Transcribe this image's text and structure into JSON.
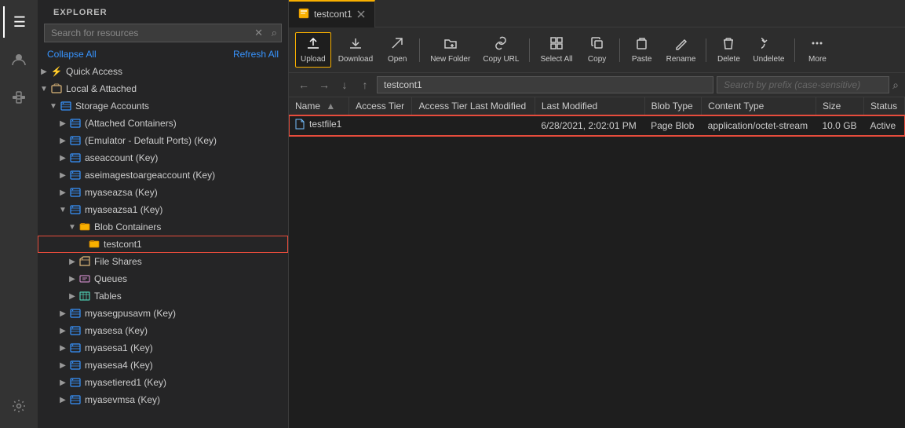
{
  "activityBar": {
    "icons": [
      {
        "name": "menu-icon",
        "glyph": "☰"
      },
      {
        "name": "account-icon",
        "glyph": "👤"
      },
      {
        "name": "plugin-icon",
        "glyph": "🔌"
      },
      {
        "name": "settings-icon",
        "glyph": "⚙"
      }
    ]
  },
  "sidebar": {
    "title": "EXPLORER",
    "search": {
      "placeholder": "Search for resources",
      "value": ""
    },
    "collapseAll": "Collapse All",
    "refreshAll": "Refresh All",
    "quickAccess": "Quick Access",
    "localAttached": "Local & Attached",
    "storageAccounts": "Storage Accounts",
    "tree": [
      {
        "id": "quick-access",
        "label": "Quick Access",
        "indent": 0,
        "chevron": "▶",
        "icon": "⚡"
      },
      {
        "id": "local-attached",
        "label": "Local & Attached",
        "indent": 0,
        "chevron": "▼",
        "icon": "📁",
        "expanded": true
      },
      {
        "id": "storage-accounts",
        "label": "Storage Accounts",
        "indent": 1,
        "chevron": "▼",
        "icon": "🗄",
        "expanded": true
      },
      {
        "id": "attached-containers",
        "label": "(Attached Containers)",
        "indent": 2,
        "chevron": "▶",
        "icon": "🗄"
      },
      {
        "id": "emulator",
        "label": "(Emulator - Default Ports) (Key)",
        "indent": 2,
        "chevron": "▶",
        "icon": "🗄"
      },
      {
        "id": "aseaccount",
        "label": "aseaccount (Key)",
        "indent": 2,
        "chevron": "▶",
        "icon": "🗄"
      },
      {
        "id": "aseimagestorage",
        "label": "aseimagestoargeaccount (Key)",
        "indent": 2,
        "chevron": "▶",
        "icon": "🗄"
      },
      {
        "id": "myaseazsa",
        "label": "myaseazsa (Key)",
        "indent": 2,
        "chevron": "▶",
        "icon": "🗄"
      },
      {
        "id": "myaseazsa1",
        "label": "myaseazsa1 (Key)",
        "indent": 2,
        "chevron": "▼",
        "icon": "🗄",
        "expanded": true
      },
      {
        "id": "blob-containers",
        "label": "Blob Containers",
        "indent": 3,
        "chevron": "▼",
        "icon": "📦",
        "expanded": true
      },
      {
        "id": "testcont1",
        "label": "testcont1",
        "indent": 4,
        "chevron": "",
        "icon": "📦",
        "selected": true,
        "highlighted": true
      },
      {
        "id": "file-shares",
        "label": "File Shares",
        "indent": 3,
        "chevron": "▶",
        "icon": "📁"
      },
      {
        "id": "queues",
        "label": "Queues",
        "indent": 3,
        "chevron": "▶",
        "icon": "📋"
      },
      {
        "id": "tables",
        "label": "Tables",
        "indent": 3,
        "chevron": "▶",
        "icon": "📊"
      },
      {
        "id": "myasegpusavm",
        "label": "myasegpusavm (Key)",
        "indent": 2,
        "chevron": "▶",
        "icon": "🗄"
      },
      {
        "id": "myasesa",
        "label": "myasesa (Key)",
        "indent": 2,
        "chevron": "▶",
        "icon": "🗄"
      },
      {
        "id": "myasesa1",
        "label": "myasesa1 (Key)",
        "indent": 2,
        "chevron": "▶",
        "icon": "🗄"
      },
      {
        "id": "myasesa4",
        "label": "myasesa4 (Key)",
        "indent": 2,
        "chevron": "▶",
        "icon": "🗄"
      },
      {
        "id": "myasetiered1",
        "label": "myasetiered1 (Key)",
        "indent": 2,
        "chevron": "▶",
        "icon": "🗄"
      },
      {
        "id": "myasevmsa",
        "label": "myasevmsa (Key)",
        "indent": 2,
        "chevron": "▶",
        "icon": "🗄"
      }
    ]
  },
  "tab": {
    "label": "testcont1",
    "icon": "📦",
    "modified": false,
    "closable": true
  },
  "toolbar": {
    "buttons": [
      {
        "id": "upload",
        "label": "Upload",
        "icon": "↑",
        "active": true
      },
      {
        "id": "download",
        "label": "Download",
        "icon": "↓",
        "active": false
      },
      {
        "id": "open",
        "label": "Open",
        "icon": "↗",
        "active": false
      },
      {
        "id": "new-folder",
        "label": "New Folder",
        "icon": "+",
        "active": false
      },
      {
        "id": "copy-url",
        "label": "Copy URL",
        "icon": "🔗",
        "active": false
      },
      {
        "id": "select-all",
        "label": "Select All",
        "icon": "⬚",
        "active": false
      },
      {
        "id": "copy",
        "label": "Copy",
        "icon": "⧉",
        "active": false
      },
      {
        "id": "paste",
        "label": "Paste",
        "icon": "📋",
        "active": false
      },
      {
        "id": "rename",
        "label": "Rename",
        "icon": "✏",
        "active": false
      },
      {
        "id": "delete",
        "label": "Delete",
        "icon": "🗑",
        "active": false
      },
      {
        "id": "undelete",
        "label": "Undelete",
        "icon": "↩",
        "active": false
      },
      {
        "id": "more",
        "label": "More",
        "icon": "•••",
        "active": false
      }
    ]
  },
  "addressBar": {
    "navBack": "←",
    "navForward": "→",
    "navDown": "↓",
    "navUp": "↑",
    "address": "testcont1",
    "searchPlaceholder": "Search by prefix (case-sensitive)"
  },
  "table": {
    "columns": [
      {
        "id": "name",
        "label": "Name",
        "sortable": true,
        "sortDir": "asc"
      },
      {
        "id": "access-tier",
        "label": "Access Tier",
        "sortable": false
      },
      {
        "id": "access-tier-last-modified",
        "label": "Access Tier Last Modified",
        "sortable": false
      },
      {
        "id": "last-modified",
        "label": "Last Modified",
        "sortable": false
      },
      {
        "id": "blob-type",
        "label": "Blob Type",
        "sortable": false
      },
      {
        "id": "content-type",
        "label": "Content Type",
        "sortable": false
      },
      {
        "id": "size",
        "label": "Size",
        "sortable": false
      },
      {
        "id": "status",
        "label": "Status",
        "sortable": false
      }
    ],
    "rows": [
      {
        "id": "testfile1",
        "name": "testfile1",
        "accessTier": "",
        "accessTierLastModified": "",
        "lastModified": "6/28/2021, 2:02:01 PM",
        "blobType": "Page Blob",
        "contentType": "application/octet-stream",
        "size": "10.0 GB",
        "status": "Active",
        "selected": true
      }
    ]
  },
  "colors": {
    "accent": "#f9b000",
    "selectedRowOutline": "#e74c3c",
    "link": "#3794ff"
  }
}
